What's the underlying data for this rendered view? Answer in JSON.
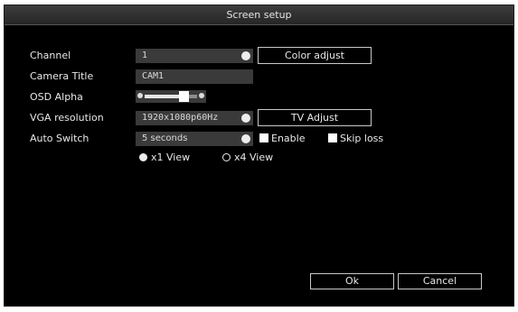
{
  "dialog": {
    "title": "Screen setup"
  },
  "fields": {
    "channel_label": "Channel",
    "channel_value": "1",
    "camera_title_label": "Camera Title",
    "camera_title_value": "CAM1",
    "osd_alpha_label": "OSD Alpha",
    "osd_alpha_level": 0.75,
    "vga_label": "VGA resolution",
    "vga_value": "1920x1080p60Hz",
    "auto_switch_label": "Auto Switch",
    "auto_switch_value": "5 seconds"
  },
  "checkboxes": {
    "enable_label": "Enable",
    "enable_checked": true,
    "skip_loss_label": "Skip loss",
    "skip_loss_checked": true
  },
  "view_mode": {
    "x1_label": "x1 View",
    "x4_label": "x4 View",
    "selected": "x1"
  },
  "buttons": {
    "color_adjust": "Color adjust",
    "tv_adjust": "TV Adjust",
    "ok": "Ok",
    "cancel": "Cancel"
  },
  "icons": {
    "dropdown": "dropdown-dot-icon",
    "slider_left": "slider-decrease-icon",
    "slider_right": "slider-increase-icon"
  },
  "colors": {
    "background": "#000000",
    "field": "#3a3a3a",
    "text": "#e8e8e8",
    "titlebar": "#2e2e2e"
  }
}
